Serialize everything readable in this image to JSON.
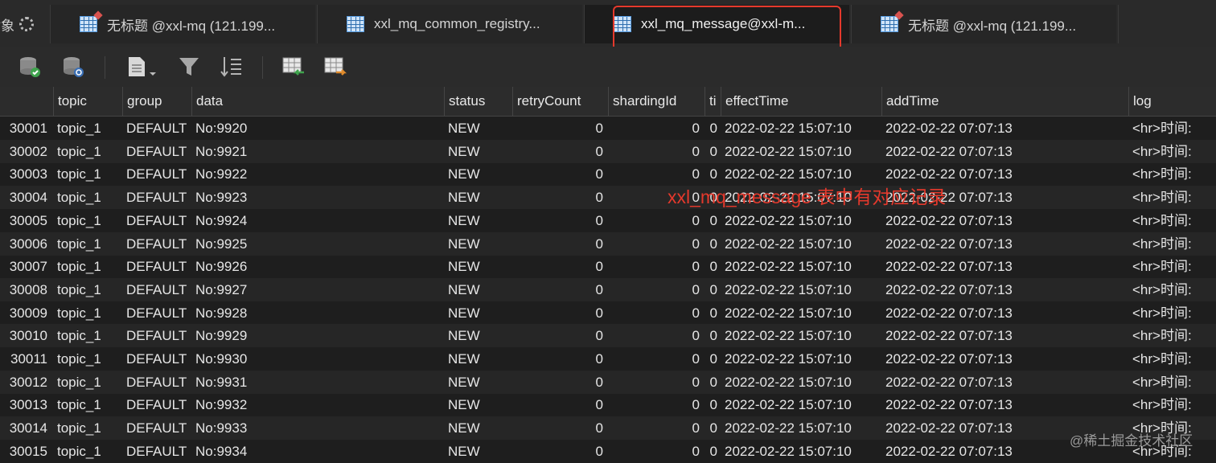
{
  "tabs": [
    {
      "label": "对象",
      "active": false
    },
    {
      "label": "无标题 @xxl-mq (121.199...",
      "active": false
    },
    {
      "label": "xxl_mq_common_registry...",
      "active": false
    },
    {
      "label": "xxl_mq_message@xxl-m...",
      "active": true
    },
    {
      "label": "无标题 @xxl-mq (121.199...",
      "active": false
    }
  ],
  "toolbar": {
    "icons": [
      "db-commit-icon",
      "db-refresh-icon",
      "document-menu-icon",
      "filter-icon",
      "sort-icon",
      "import-table-icon",
      "export-table-icon"
    ]
  },
  "table": {
    "columns": [
      "",
      "topic",
      "group",
      "data",
      "status",
      "retryCount",
      "shardingId",
      "ti",
      "effectTime",
      "addTime",
      "log"
    ],
    "rows": [
      [
        "30001",
        "topic_1",
        "DEFAULT",
        "No:9920",
        "NEW",
        "0",
        "0",
        "0",
        "2022-02-22 15:07:10",
        "2022-02-22 07:07:13",
        "<hr>时间:"
      ],
      [
        "30002",
        "topic_1",
        "DEFAULT",
        "No:9921",
        "NEW",
        "0",
        "0",
        "0",
        "2022-02-22 15:07:10",
        "2022-02-22 07:07:13",
        "<hr>时间:"
      ],
      [
        "30003",
        "topic_1",
        "DEFAULT",
        "No:9922",
        "NEW",
        "0",
        "0",
        "0",
        "2022-02-22 15:07:10",
        "2022-02-22 07:07:13",
        "<hr>时间:"
      ],
      [
        "30004",
        "topic_1",
        "DEFAULT",
        "No:9923",
        "NEW",
        "0",
        "0",
        "0",
        "2022-02-22 15:07:10",
        "2022-02-22 07:07:13",
        "<hr>时间:"
      ],
      [
        "30005",
        "topic_1",
        "DEFAULT",
        "No:9924",
        "NEW",
        "0",
        "0",
        "0",
        "2022-02-22 15:07:10",
        "2022-02-22 07:07:13",
        "<hr>时间:"
      ],
      [
        "30006",
        "topic_1",
        "DEFAULT",
        "No:9925",
        "NEW",
        "0",
        "0",
        "0",
        "2022-02-22 15:07:10",
        "2022-02-22 07:07:13",
        "<hr>时间:"
      ],
      [
        "30007",
        "topic_1",
        "DEFAULT",
        "No:9926",
        "NEW",
        "0",
        "0",
        "0",
        "2022-02-22 15:07:10",
        "2022-02-22 07:07:13",
        "<hr>时间:"
      ],
      [
        "30008",
        "topic_1",
        "DEFAULT",
        "No:9927",
        "NEW",
        "0",
        "0",
        "0",
        "2022-02-22 15:07:10",
        "2022-02-22 07:07:13",
        "<hr>时间:"
      ],
      [
        "30009",
        "topic_1",
        "DEFAULT",
        "No:9928",
        "NEW",
        "0",
        "0",
        "0",
        "2022-02-22 15:07:10",
        "2022-02-22 07:07:13",
        "<hr>时间:"
      ],
      [
        "30010",
        "topic_1",
        "DEFAULT",
        "No:9929",
        "NEW",
        "0",
        "0",
        "0",
        "2022-02-22 15:07:10",
        "2022-02-22 07:07:13",
        "<hr>时间:"
      ],
      [
        "30011",
        "topic_1",
        "DEFAULT",
        "No:9930",
        "NEW",
        "0",
        "0",
        "0",
        "2022-02-22 15:07:10",
        "2022-02-22 07:07:13",
        "<hr>时间:"
      ],
      [
        "30012",
        "topic_1",
        "DEFAULT",
        "No:9931",
        "NEW",
        "0",
        "0",
        "0",
        "2022-02-22 15:07:10",
        "2022-02-22 07:07:13",
        "<hr>时间:"
      ],
      [
        "30013",
        "topic_1",
        "DEFAULT",
        "No:9932",
        "NEW",
        "0",
        "0",
        "0",
        "2022-02-22 15:07:10",
        "2022-02-22 07:07:13",
        "<hr>时间:"
      ],
      [
        "30014",
        "topic_1",
        "DEFAULT",
        "No:9933",
        "NEW",
        "0",
        "0",
        "0",
        "2022-02-22 15:07:10",
        "2022-02-22 07:07:13",
        "<hr>时间:"
      ],
      [
        "30015",
        "topic_1",
        "DEFAULT",
        "No:9934",
        "NEW",
        "0",
        "0",
        "0",
        "2022-02-22 15:07:10",
        "2022-02-22 07:07:13",
        "<hr>时间:"
      ]
    ]
  },
  "annotation": "xxl_mq_message 表中有对应记录",
  "watermark": "@稀土掘金技术社区",
  "colors": {
    "annotation": "#e5392c",
    "highlight_box": "#e5392c",
    "table_icon": "#2e6fb0"
  }
}
